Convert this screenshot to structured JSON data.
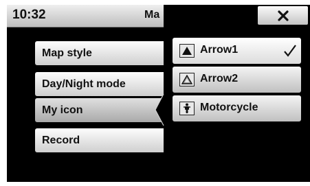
{
  "status": {
    "time": "10:32",
    "title_truncated": "Ma"
  },
  "menu": {
    "items": [
      {
        "label": "Map style"
      },
      {
        "label": "Day/Night mode"
      },
      {
        "label": "My icon"
      },
      {
        "label": "Record"
      }
    ],
    "active_item": "My icon"
  },
  "close_button": {
    "glyph": "✕"
  },
  "icon_options": {
    "items": [
      {
        "label": "Arrow1",
        "icon": "arrow-filled-icon",
        "selected": true
      },
      {
        "label": "Arrow2",
        "icon": "arrow-outline-icon",
        "selected": false
      },
      {
        "label": "Motorcycle",
        "icon": "motorcycle-icon",
        "selected": false
      }
    ]
  },
  "colors": {
    "background": "#000000",
    "button_light": "#f4f4f4",
    "button_dark": "#c0c0c0",
    "text": "#111111"
  }
}
